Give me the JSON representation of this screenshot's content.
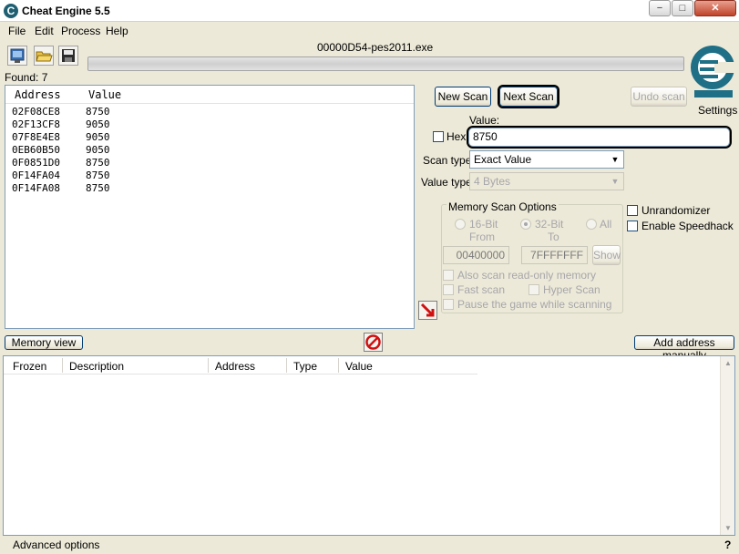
{
  "window": {
    "title": "Cheat Engine 5.5",
    "icon": "cheat-engine-icon"
  },
  "caption_buttons": {
    "minimize": "−",
    "maximize": "□",
    "close": "✕"
  },
  "menu": {
    "items": [
      "File",
      "Edit",
      "Process",
      "Help"
    ]
  },
  "toolbar": {
    "icons": [
      "select-process-icon",
      "open-file-icon",
      "save-icon"
    ]
  },
  "process": {
    "name": "00000D54-pes2011.exe"
  },
  "found": {
    "label": "Found: 7"
  },
  "settings": {
    "label": "Settings"
  },
  "results": {
    "headers": {
      "address": "Address",
      "value": "Value"
    },
    "rows": [
      {
        "address": "02F08CE8",
        "value": "8750"
      },
      {
        "address": "02F13CF8",
        "value": "9050"
      },
      {
        "address": "07F8E4E8",
        "value": "9050"
      },
      {
        "address": "0EB60B50",
        "value": "9050"
      },
      {
        "address": "0F0851D0",
        "value": "8750"
      },
      {
        "address": "0F14FA04",
        "value": "8750"
      },
      {
        "address": "0F14FA08",
        "value": "8750"
      }
    ]
  },
  "scan": {
    "new_scan": "New Scan",
    "next_scan": "Next Scan",
    "undo_scan": "Undo scan",
    "value_label": "Value:",
    "hex_label": "Hex",
    "value": "8750",
    "scan_type_label": "Scan type",
    "scan_type": "Exact Value",
    "value_type_label": "Value type",
    "value_type": "4 Bytes"
  },
  "memory_scan_options": {
    "title": "Memory Scan Options",
    "bit16": "16-Bit",
    "bit32": "32-Bit",
    "all": "All",
    "from_label": "From",
    "to_label": "To",
    "from": "00400000",
    "to": "7FFFFFFF",
    "show": "Show",
    "also_scan_readonly": "Also scan read-only memory",
    "fast_scan": "Fast scan",
    "hyper_scan": "Hyper Scan",
    "pause_game": "Pause the game while scanning"
  },
  "options": {
    "unrandomizer": "Unrandomizer",
    "enable_speedhack": "Enable Speedhack"
  },
  "bottom": {
    "memory_view": "Memory view",
    "add_address_manually": "Add address manually",
    "advanced_options": "Advanced options",
    "help": "?"
  },
  "cheat_table": {
    "headers": [
      "Frozen",
      "Description",
      "Address",
      "Type",
      "Value"
    ]
  }
}
